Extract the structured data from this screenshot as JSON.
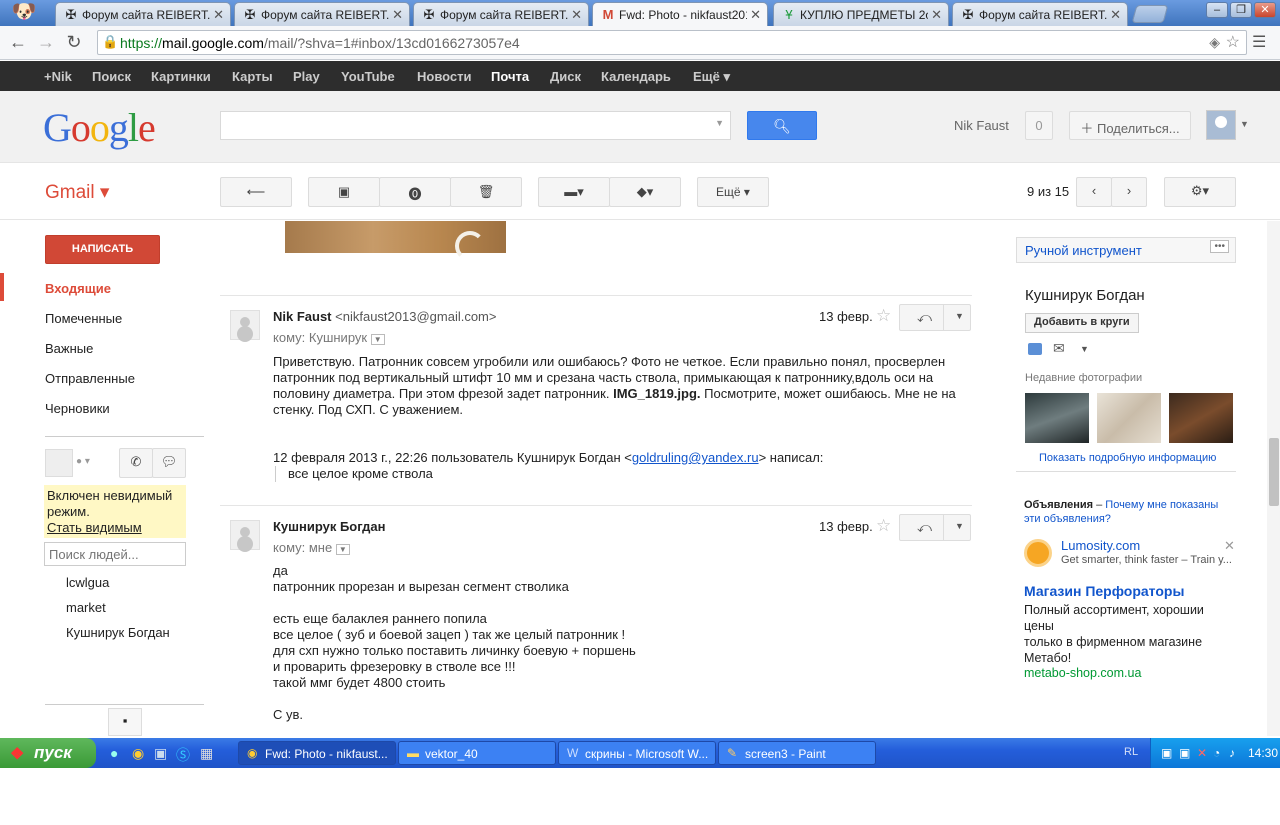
{
  "browser": {
    "tabs": [
      {
        "label": "Форум сайта REIBERT.inf",
        "icon": "cross-icon",
        "active": false
      },
      {
        "label": "Форум сайта REIBERT.inf",
        "icon": "cross-icon",
        "active": false
      },
      {
        "label": "Форум сайта REIBERT.inf",
        "icon": "cross-icon",
        "active": false
      },
      {
        "label": "Fwd: Photo - nikfaust201",
        "icon": "gmail-icon",
        "active": true
      },
      {
        "label": "КУПЛЮ ПРЕДМЕТЫ 2ой",
        "icon": "tree-icon",
        "active": false
      },
      {
        "label": "Форум сайта REIBERT.inf",
        "icon": "cross-icon",
        "active": false
      }
    ],
    "url_scheme": "https://",
    "url_host": "mail.google.com",
    "url_path": "/mail/?shva=1#inbox/13cd0166273057e4"
  },
  "gbar": {
    "items": [
      "+Nik",
      "Поиск",
      "Картинки",
      "Карты",
      "Play",
      "YouTube",
      "Новости",
      "Почта",
      "Диск",
      "Календарь",
      "Ещё ▾"
    ],
    "current": "Почта"
  },
  "header": {
    "logo": "Google",
    "user": "Nik Faust",
    "count": "0",
    "share": "Поделиться..."
  },
  "gmail": {
    "label": "Gmail ▾",
    "more": "Ещё ▾",
    "pager": "9 из 15"
  },
  "left": {
    "compose": "НАПИСАТЬ",
    "nav": [
      "Входящие",
      "Помеченные",
      "Важные",
      "Отправленные",
      "Черновики"
    ],
    "invisible_notice": "Включен невидимый режим.",
    "invisible_link": "Стать видимым",
    "people_placeholder": "Поиск людей...",
    "contacts": [
      "lcwlgua",
      "market",
      "Кушнирук Богдан"
    ]
  },
  "messages": [
    {
      "sender": "Nik Faust",
      "email": "<nikfaust2013@gmail.com>",
      "to": "кому: Кушнирук",
      "date": "13 февр.",
      "body": "Приветствую. Патронник совсем угробили или ошибаюсь? Фото не четкое. Если правильно понял, просверлен патронник под вертикальный штифт 10 мм и срезана часть ствола, примыкающая к патроннику,вдоль оси на половину диаметра. При этом фрезой задет патронник.",
      "attachment": "IMG_1819.jpg.",
      "body_end": "Посмотрите, может ошибаюсь. Мне не на стенку. Под СХП. С уважением.",
      "quote_intro": "12 февраля 2013 г., 22:26 пользователь Кушнирук Богдан <",
      "quote_email": "goldruling@yandex.ru",
      "quote_end": "> написал:",
      "quote_text": "все целое кроме ствола"
    },
    {
      "sender": "Кушнирук Богдан",
      "to": "кому: мне",
      "date": "13 февр.",
      "lines": [
        "да",
        "патронник прорезан и вырезан сегмент стволика",
        "",
        "есть еще балаклея раннего попила",
        "все целое ( зуб и боевой зацеп ) так же целый патронник !",
        "для схп нужно только поставить личинку боевую + поршень",
        "и проварить фрезеровку в стволе все !!!",
        "такой ммг будет 4800 стоить",
        "",
        "С ув."
      ]
    }
  ],
  "right": {
    "tool": "Ручной инструмент",
    "contact_name": "Кушнирук Богдан",
    "add_circles": "Добавить в круги",
    "recent_photos": "Недавние фотографии",
    "show_info": "Показать подробную информацию",
    "ads_title": "Объявления",
    "ads_why": "Почему мне показаны эти объявления?",
    "ad1_title": "Lumosity.com",
    "ad1_text": "Get smarter, think faster – Train y...",
    "ad2_title": "Магазин Перфораторы",
    "ad2_text": "Полный ассортимент, хорошии цены",
    "ad2_text2": "только в фирменном магазине Метабо!",
    "ad2_url": "metabo-shop.com.ua"
  },
  "taskbar": {
    "start": "пуск",
    "tasks": [
      "Fwd: Photo - nikfaust...",
      "vektor_40",
      "скрины - Microsoft W...",
      "screen3 - Paint"
    ],
    "lang": "RL",
    "clock": "14:30"
  }
}
